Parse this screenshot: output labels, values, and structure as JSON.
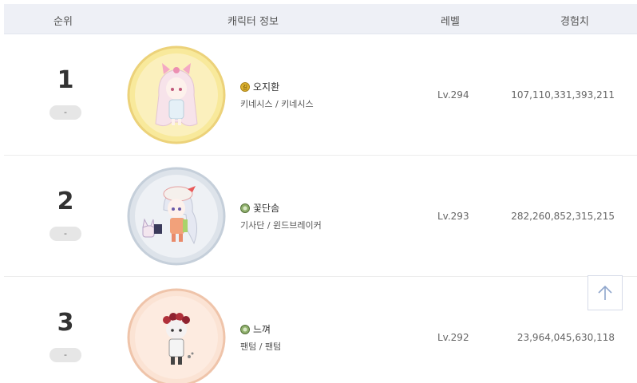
{
  "table": {
    "headers": {
      "rank": "순위",
      "info": "캐릭터 정보",
      "level": "레벨",
      "exp": "경험치"
    },
    "rows": [
      {
        "rank": "1",
        "change": "-",
        "name": "오지환",
        "job": "키네시스 / 키네시스",
        "level": "Lv.294",
        "exp": "107,110,331,393,211",
        "avatar_icon": "character-avatar-pink-bow",
        "avatar_bg": "#f8e99b"
      },
      {
        "rank": "2",
        "change": "-",
        "name": "꽃단솜",
        "job": "기사단 / 윈드브레이커",
        "level": "Lv.293",
        "exp": "282,260,852,315,215",
        "avatar_icon": "character-avatar-white-hair",
        "avatar_bg": "#dde3ea"
      },
      {
        "rank": "3",
        "change": "-",
        "name": "느껴",
        "job": "팬텀 / 팬텀",
        "level": "Lv.292",
        "exp": "23,964,045,630,118",
        "avatar_icon": "character-avatar-rose-crown",
        "avatar_bg": "#fbe3d4"
      }
    ]
  },
  "scroll_top_icon": "arrow-up-icon"
}
